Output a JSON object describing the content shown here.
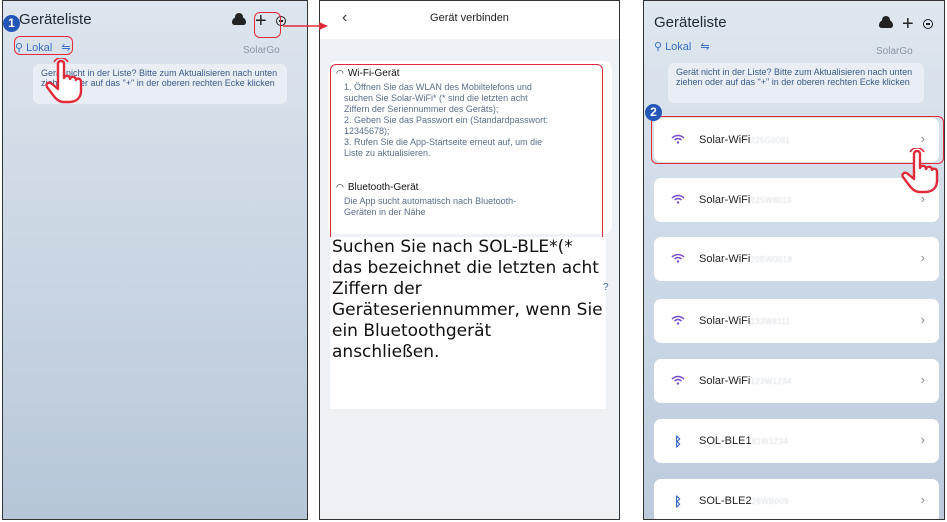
{
  "screen1": {
    "title": "Geräteliste",
    "location": "Lokal",
    "brand": "SolarGo",
    "note": "Gerät nicht in der Liste? Bitte zum Aktualisieren nach unten ziehen oder auf das \"+\" in der oberen rechten Ecke klicken",
    "badge": "1"
  },
  "screen2": {
    "back_icon": "chevron-left-icon",
    "title": "Gerät verbinden",
    "wifi_title": "Wi-Fi-Gerät",
    "wifi_steps": [
      "1. Öffnen Sie das WLAN des Mobiltelefons und",
      "suchen Sie Solar-WiFi* (* sind die letzten acht",
      "Ziffern der Seriennummer des Geräts);",
      "2. Geben Sie das Passwort ein (Standardpasswort:",
      "12345678);",
      "3. Rufen Sie die App-Startseite erneut auf, um die",
      "Liste zu aktualisieren."
    ],
    "bt_title": "Bluetooth-Gerät",
    "bt_text": [
      "Die App sucht automatisch nach Bluetooth-",
      "Geräten in der Nähe"
    ],
    "overlay_text": "Suchen Sie nach SOL-BLE*(* das bezeichnet die letzten acht Ziffern der Geräteseriennummer, wenn Sie ein Bluetoothgerät anschließen.",
    "qmark": "?"
  },
  "screen3": {
    "title": "Geräteliste",
    "location": "Lokal",
    "brand": "SolarGo",
    "note": "Gerät nicht in der Liste? Bitte zum Aktualisieren nach unten ziehen oder auf das \"+\" in der oberen rechten Ecke klicken",
    "badge": "2",
    "devices": [
      {
        "name": "Solar-WiFi",
        "suffix": "225G0081",
        "type": "wifi"
      },
      {
        "name": "Solar-WiFi",
        "suffix": "225W8013",
        "type": "wifi"
      },
      {
        "name": "Solar-WiFi",
        "suffix": "20BW0018",
        "type": "wifi"
      },
      {
        "name": "Solar-WiFi",
        "suffix": "233W8111",
        "type": "wifi"
      },
      {
        "name": "Solar-WiFi",
        "suffix": "123W1234",
        "type": "wifi"
      },
      {
        "name": "SOL-BLE1",
        "suffix": "81W1234",
        "type": "bluetooth"
      },
      {
        "name": "SOL-BLE2",
        "suffix": "26WB009",
        "type": "bluetooth"
      }
    ]
  },
  "colors": {
    "highlight": "#e22b3a",
    "badge": "#2456b7",
    "accent": "#3a6fc4",
    "wifi_icon": "#7a4fc9"
  }
}
